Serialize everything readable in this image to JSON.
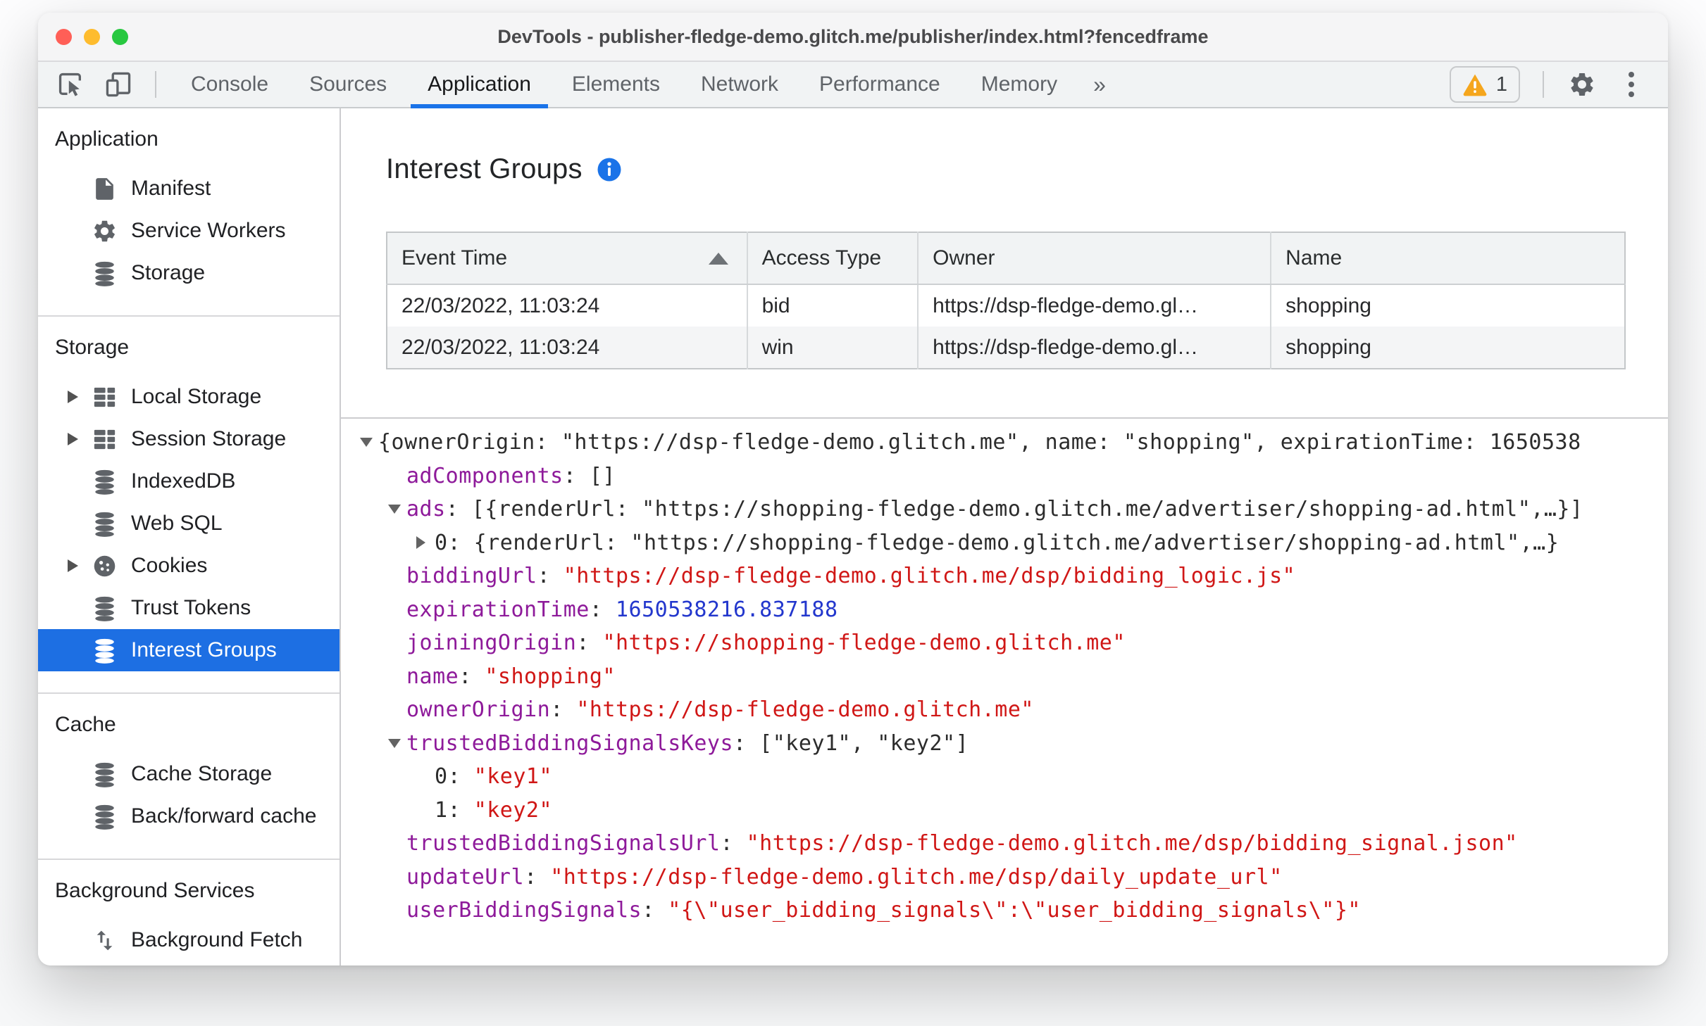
{
  "window": {
    "title": "DevTools - publisher-fledge-demo.glitch.me/publisher/index.html?fencedframe",
    "traffic_lights": [
      "close",
      "minimize",
      "zoom"
    ]
  },
  "toolbar": {
    "left_icons": [
      "inspect-icon",
      "device-toolbar-icon"
    ],
    "tabs": [
      {
        "label": "Console",
        "active": false
      },
      {
        "label": "Sources",
        "active": false
      },
      {
        "label": "Application",
        "active": true
      },
      {
        "label": "Elements",
        "active": false
      },
      {
        "label": "Network",
        "active": false
      },
      {
        "label": "Performance",
        "active": false
      },
      {
        "label": "Memory",
        "active": false
      }
    ],
    "more_tabs_symbol": "»",
    "warning": {
      "icon": "warning-icon",
      "count": "1"
    },
    "right_icons": [
      "gear-icon",
      "kebab-menu-icon"
    ]
  },
  "sidebar": {
    "sections": [
      {
        "title": "Application",
        "items": [
          {
            "label": "Manifest",
            "icon": "document"
          },
          {
            "label": "Service Workers",
            "icon": "gear"
          },
          {
            "label": "Storage",
            "icon": "database"
          }
        ]
      },
      {
        "title": "Storage",
        "items": [
          {
            "label": "Local Storage",
            "icon": "datagrid",
            "expander": true
          },
          {
            "label": "Session Storage",
            "icon": "datagrid",
            "expander": true
          },
          {
            "label": "IndexedDB",
            "icon": "database"
          },
          {
            "label": "Web SQL",
            "icon": "database"
          },
          {
            "label": "Cookies",
            "icon": "cookie",
            "expander": true
          },
          {
            "label": "Trust Tokens",
            "icon": "database"
          },
          {
            "label": "Interest Groups",
            "icon": "database",
            "selected": true
          }
        ]
      },
      {
        "title": "Cache",
        "items": [
          {
            "label": "Cache Storage",
            "icon": "database"
          },
          {
            "label": "Back/forward cache",
            "icon": "database"
          }
        ]
      },
      {
        "title": "Background Services",
        "items": [
          {
            "label": "Background Fetch",
            "icon": "fetch"
          }
        ]
      }
    ]
  },
  "main": {
    "title": "Interest Groups",
    "info_icon": "info-icon",
    "table": {
      "columns": [
        {
          "label": "Event Time",
          "sort": "asc"
        },
        {
          "label": "Access Type"
        },
        {
          "label": "Owner"
        },
        {
          "label": "Name"
        }
      ],
      "rows": [
        [
          "22/03/2022, 11:03:24",
          "bid",
          "https://dsp-fledge-demo.gl…",
          "shopping"
        ],
        [
          "22/03/2022, 11:03:24",
          "win",
          "https://dsp-fledge-demo.gl…",
          "shopping"
        ]
      ]
    },
    "tree": {
      "lines": [
        {
          "indent": 0,
          "arrow": "down",
          "segments": [
            {
              "t": "{ownerOrigin: \"https://dsp-fledge-demo.glitch.me\", name: \"shopping\", expirationTime: 1650538",
              "c": "plain"
            }
          ]
        },
        {
          "indent": 1,
          "arrow": null,
          "segments": [
            {
              "t": "adComponents",
              "c": "key"
            },
            {
              "t": ": []",
              "c": "plain"
            }
          ]
        },
        {
          "indent": 1,
          "arrow": "down",
          "segments": [
            {
              "t": "ads",
              "c": "key"
            },
            {
              "t": ": [{renderUrl: \"https://shopping-fledge-demo.glitch.me/advertiser/shopping-ad.html\",…}]",
              "c": "plain"
            }
          ]
        },
        {
          "indent": 2,
          "arrow": "right",
          "segments": [
            {
              "t": "0",
              "c": "plain"
            },
            {
              "t": ": {renderUrl: \"https://shopping-fledge-demo.glitch.me/advertiser/shopping-ad.html\",…}",
              "c": "plain"
            }
          ]
        },
        {
          "indent": 1,
          "arrow": null,
          "segments": [
            {
              "t": "biddingUrl",
              "c": "key"
            },
            {
              "t": ": ",
              "c": "plain"
            },
            {
              "t": "\"https://dsp-fledge-demo.glitch.me/dsp/bidding_logic.js\"",
              "c": "string"
            }
          ]
        },
        {
          "indent": 1,
          "arrow": null,
          "segments": [
            {
              "t": "expirationTime",
              "c": "key"
            },
            {
              "t": ": ",
              "c": "plain"
            },
            {
              "t": "1650538216.837188",
              "c": "number"
            }
          ]
        },
        {
          "indent": 1,
          "arrow": null,
          "segments": [
            {
              "t": "joiningOrigin",
              "c": "key"
            },
            {
              "t": ": ",
              "c": "plain"
            },
            {
              "t": "\"https://shopping-fledge-demo.glitch.me\"",
              "c": "string"
            }
          ]
        },
        {
          "indent": 1,
          "arrow": null,
          "segments": [
            {
              "t": "name",
              "c": "key"
            },
            {
              "t": ": ",
              "c": "plain"
            },
            {
              "t": "\"shopping\"",
              "c": "string"
            }
          ]
        },
        {
          "indent": 1,
          "arrow": null,
          "segments": [
            {
              "t": "ownerOrigin",
              "c": "key"
            },
            {
              "t": ": ",
              "c": "plain"
            },
            {
              "t": "\"https://dsp-fledge-demo.glitch.me\"",
              "c": "string"
            }
          ]
        },
        {
          "indent": 1,
          "arrow": "down",
          "segments": [
            {
              "t": "trustedBiddingSignalsKeys",
              "c": "key"
            },
            {
              "t": ": [\"key1\", \"key2\"]",
              "c": "plain"
            }
          ]
        },
        {
          "indent": 2,
          "arrow": null,
          "segments": [
            {
              "t": "0",
              "c": "plain"
            },
            {
              "t": ": ",
              "c": "plain"
            },
            {
              "t": "\"key1\"",
              "c": "string"
            }
          ]
        },
        {
          "indent": 2,
          "arrow": null,
          "segments": [
            {
              "t": "1",
              "c": "plain"
            },
            {
              "t": ": ",
              "c": "plain"
            },
            {
              "t": "\"key2\"",
              "c": "string"
            }
          ]
        },
        {
          "indent": 1,
          "arrow": null,
          "segments": [
            {
              "t": "trustedBiddingSignalsUrl",
              "c": "key"
            },
            {
              "t": ": ",
              "c": "plain"
            },
            {
              "t": "\"https://dsp-fledge-demo.glitch.me/dsp/bidding_signal.json\"",
              "c": "string"
            }
          ]
        },
        {
          "indent": 1,
          "arrow": null,
          "segments": [
            {
              "t": "updateUrl",
              "c": "key"
            },
            {
              "t": ": ",
              "c": "plain"
            },
            {
              "t": "\"https://dsp-fledge-demo.glitch.me/dsp/daily_update_url\"",
              "c": "string"
            }
          ]
        },
        {
          "indent": 1,
          "arrow": null,
          "segments": [
            {
              "t": "userBiddingSignals",
              "c": "key"
            },
            {
              "t": ": ",
              "c": "plain"
            },
            {
              "t": "\"{\\\"user_bidding_signals\\\":\\\"user_bidding_signals\\\"}\"",
              "c": "string"
            }
          ]
        }
      ]
    }
  },
  "colors": {
    "accent": "#1a73e8",
    "selected_row": "#1d6fe3",
    "warning": "#f5a61d",
    "json_key": "#8e1a9a",
    "json_string": "#d01716",
    "json_number": "#2337cd"
  }
}
